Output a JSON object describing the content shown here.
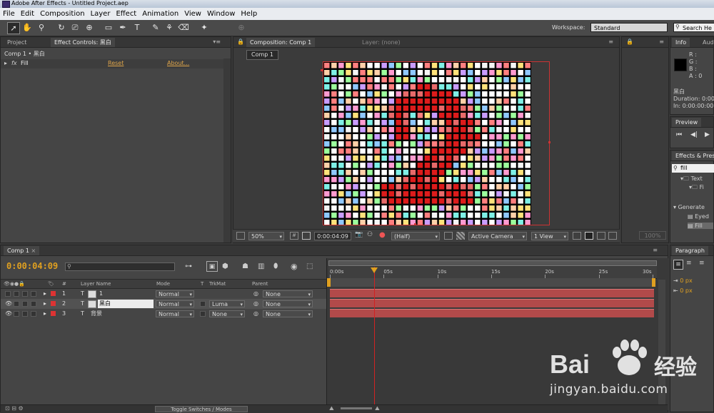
{
  "window": {
    "title": "Adobe After Effects - Untitled Project.aep"
  },
  "menu": [
    "File",
    "Edit",
    "Composition",
    "Layer",
    "Effect",
    "Animation",
    "View",
    "Window",
    "Help"
  ],
  "toolbar": {
    "workspace_label": "Workspace:",
    "workspace_value": "Standard",
    "search_help": "Search He"
  },
  "project_panel": {
    "tab_project": "Project",
    "tab_effect_controls": "Effect Controls: 黑白",
    "breadcrumb": "Comp 1 • 黑白",
    "effect_name": "Fill",
    "reset": "Reset",
    "about": "About..."
  },
  "composition_panel": {
    "tab_label": "Composition: Comp 1",
    "layer_tab": "Layer: (none)",
    "comp_button": "Comp 1",
    "zoom": "50%",
    "timecode": "0:00:04:09",
    "resolution": "(Half)",
    "camera": "Active Camera",
    "view": "1 View",
    "footer_zoom": "100%"
  },
  "info_panel": {
    "tab": "Info",
    "tab_audio": "Aud",
    "r": "R :",
    "g": "G :",
    "b": "B :",
    "a": "A : 0",
    "layer_name": "黑白",
    "duration": "Duration: 0:00",
    "in_point": "In: 0:00:00:00"
  },
  "preview_panel": {
    "tab": "Preview"
  },
  "effects_panel": {
    "tab": "Effects & Pres",
    "search_value": "fill",
    "item_text": "Text",
    "item_fi": "Fi",
    "generate": "Generate",
    "eyedropper": "Eyed",
    "fill_item": "Fill"
  },
  "paragraph_panel": {
    "tab": "Paragraph",
    "px1": "0 px",
    "px2": "0 px"
  },
  "timeline": {
    "tab": "Comp 1",
    "timecode": "0:00:04:09",
    "search_placeholder": "",
    "col_layer_name": "Layer Name",
    "col_mode": "Mode",
    "col_t": "T",
    "col_trkmat": "TrkMat",
    "col_parent": "Parent",
    "col_num": "#",
    "ruler_labels": [
      "0:00s",
      "05s",
      "10s",
      "15s",
      "20s",
      "25s",
      "30s"
    ],
    "current_time_fraction": 0.138,
    "layers": [
      {
        "num": "1",
        "name": "1",
        "mode": "Normal",
        "trkmat": "",
        "parent": "None"
      },
      {
        "num": "2",
        "name": "黑白",
        "mode": "Normal",
        "trkmat": "Luma",
        "parent": "None"
      },
      {
        "num": "3",
        "name": "背景",
        "mode": "Normal",
        "trkmat": "None",
        "parent": "None"
      }
    ],
    "toggle_label": "Toggle Switches / Modes"
  },
  "watermark": {
    "brand": "Bai",
    "cn": "经验",
    "url": "jingyan.baidu.com"
  },
  "colors": {
    "accent_time": "#e0a020",
    "current_time_line": "#d22222",
    "layer_bar": "#b24a4a",
    "comp_red": "#dd1b1b"
  }
}
